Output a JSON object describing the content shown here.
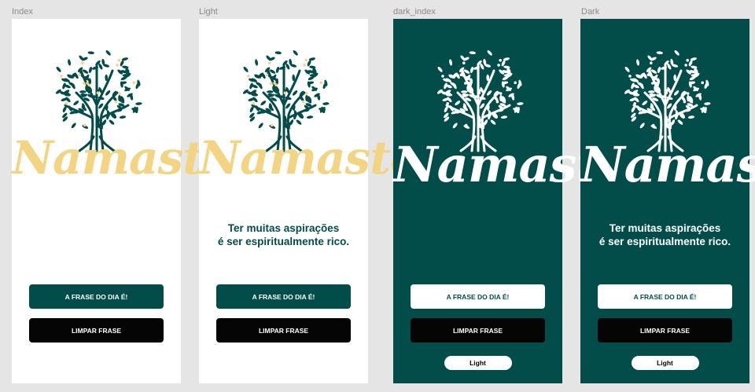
{
  "colors": {
    "canvas": "#e5e5e5",
    "light_bg": "#ffffff",
    "dark_bg": "#024c4a",
    "brand_green": "#024c4a",
    "brand_yellow": "#f3d483",
    "black_button": "#050505"
  },
  "frames": [
    {
      "label": "Index",
      "theme": "light",
      "logo_text": "Namaste",
      "quote_line1": "",
      "quote_line2": "",
      "primary_button": "A FRASE DO DIA É!",
      "clear_button": "LIMPAR FRASE",
      "toggle_button": ""
    },
    {
      "label": "Light",
      "theme": "light",
      "logo_text": "Namaste",
      "quote_line1": "Ter muitas aspirações",
      "quote_line2": "é ser espiritualmente rico.",
      "primary_button": "A FRASE DO DIA É!",
      "clear_button": "LIMPAR FRASE",
      "toggle_button": ""
    },
    {
      "label": "dark_index",
      "theme": "dark",
      "logo_text": "Namaste",
      "quote_line1": "",
      "quote_line2": "",
      "primary_button": "A FRASE DO DIA É!",
      "clear_button": "LIMPAR FRASE",
      "toggle_button": "Light"
    },
    {
      "label": "Dark",
      "theme": "dark",
      "logo_text": "Namaste",
      "quote_line1": "Ter muitas aspirações",
      "quote_line2": "é ser espiritualmente rico.",
      "primary_button": "A FRASE DO DIA É!",
      "clear_button": "LIMPAR FRASE",
      "toggle_button": "Light"
    }
  ],
  "icons": {
    "logo": "tree-icon"
  }
}
